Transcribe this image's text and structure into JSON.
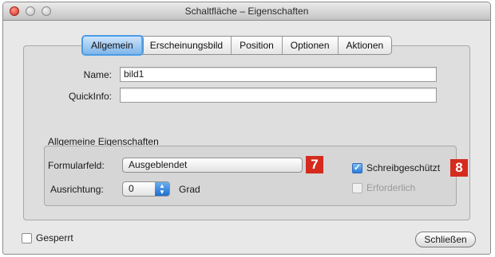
{
  "window": {
    "title": "Schaltfläche – Eigenschaften"
  },
  "tabs": [
    {
      "label": "Allgemein",
      "active": true
    },
    {
      "label": "Erscheinungsbild",
      "active": false
    },
    {
      "label": "Position",
      "active": false
    },
    {
      "label": "Optionen",
      "active": false
    },
    {
      "label": "Aktionen",
      "active": false
    }
  ],
  "form": {
    "name_label": "Name:",
    "name_value": "bild1",
    "tooltip_label": "QuickInfo:",
    "tooltip_value": ""
  },
  "general": {
    "section_title": "Allgemeine Eigenschaften",
    "formfield_label": "Formularfeld:",
    "formfield_value": "Ausgeblendet",
    "rotation_label": "Ausrichtung:",
    "rotation_value": "0",
    "rotation_unit": "Grad",
    "readonly_label": "Schreibgeschützt",
    "readonly_checked": true,
    "required_label": "Erforderlich",
    "required_checked": false,
    "required_enabled": false
  },
  "markers": {
    "marker_7": "7",
    "marker_8": "8",
    "color": "#d52b1e"
  },
  "footer": {
    "locked_label": "Gesperrt",
    "locked_checked": false,
    "close_label": "Schließen"
  },
  "icons": {
    "close": "close-icon",
    "minimize": "minimize-icon",
    "zoom": "zoom-icon",
    "stepper": "stepper-arrows-icon",
    "check": "checkmark-icon"
  },
  "colors": {
    "accent": "#4a9be6",
    "window_bg": "#e8e8e8"
  }
}
